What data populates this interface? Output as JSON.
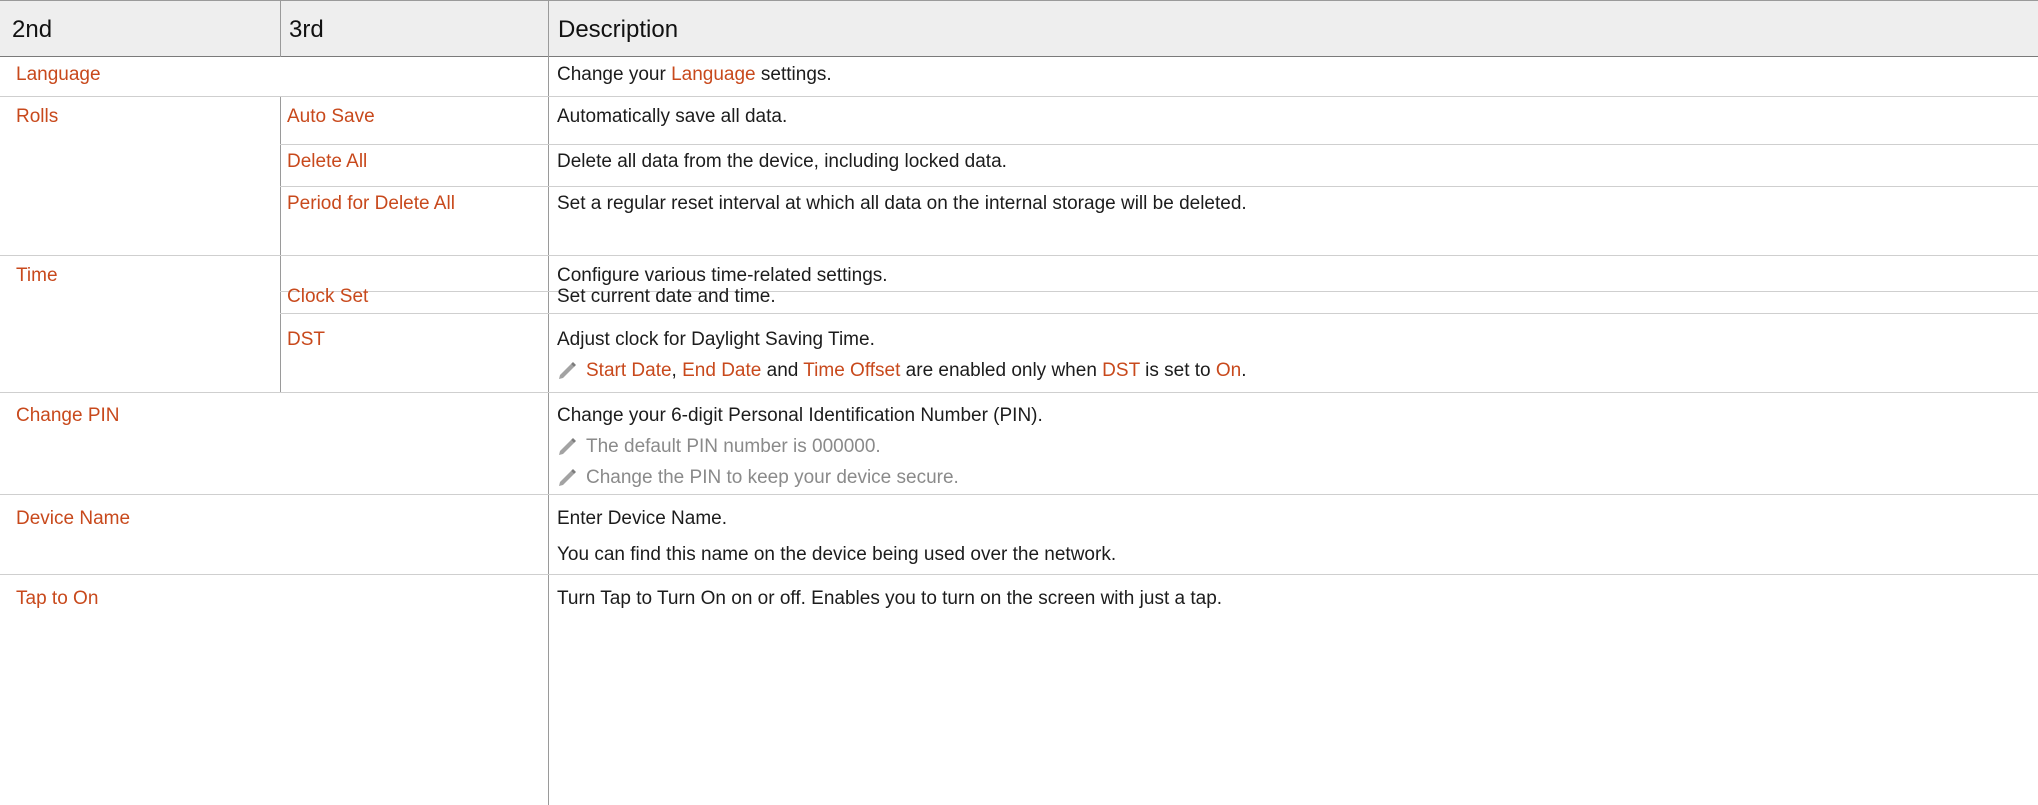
{
  "headers": {
    "col2": "2nd",
    "col3": "3rd",
    "desc": "Description"
  },
  "rows": {
    "language": {
      "name": "Language",
      "desc_prefix": "Change your ",
      "desc_term": "Language",
      "desc_suffix": " settings."
    },
    "rolls": {
      "name": "Rolls"
    },
    "auto_save": {
      "name": "Auto Save",
      "desc": "Automatically save all data."
    },
    "delete_all": {
      "name": "Delete All",
      "desc": "Delete all data from the device, including locked data."
    },
    "period": {
      "name": "Period for Delete All",
      "desc": "Set a regular reset interval at which all data on the internal storage will be deleted."
    },
    "time": {
      "name": "Time",
      "desc": "Configure various time-related settings."
    },
    "clock_set": {
      "name": "Clock Set",
      "desc": "Set current date and time."
    },
    "dst": {
      "name": "DST",
      "desc": "Adjust clock for Daylight Saving Time.",
      "note": {
        "t1": "Start Date",
        "s1": ", ",
        "t2": "End Date",
        "s2": " and ",
        "t3": "Time Offset",
        "s3": " are enabled only when ",
        "t4": "DST",
        "s4": " is set to ",
        "t5": "On",
        "s5": "."
      }
    },
    "change_pin": {
      "name": "Change PIN",
      "desc": "Change your 6-digit Personal Identification Number (PIN).",
      "note1": "The default PIN number is 000000.",
      "note2": "Change the PIN to keep your device secure."
    },
    "device_name": {
      "name": "Device Name",
      "desc1": "Enter Device Name.",
      "desc2": "You can find this name on the device being used over the network."
    },
    "tap_to_on": {
      "name": "Tap to On",
      "desc": "Turn Tap to Turn On on or off. Enables you to turn on the screen with just a tap."
    }
  },
  "colors": {
    "accent": "#c8491c",
    "header_bg": "#eeeeee",
    "note_gray": "#8a8a8a",
    "text": "#1c1c1c"
  },
  "icons": {
    "note": "pencil-icon"
  }
}
